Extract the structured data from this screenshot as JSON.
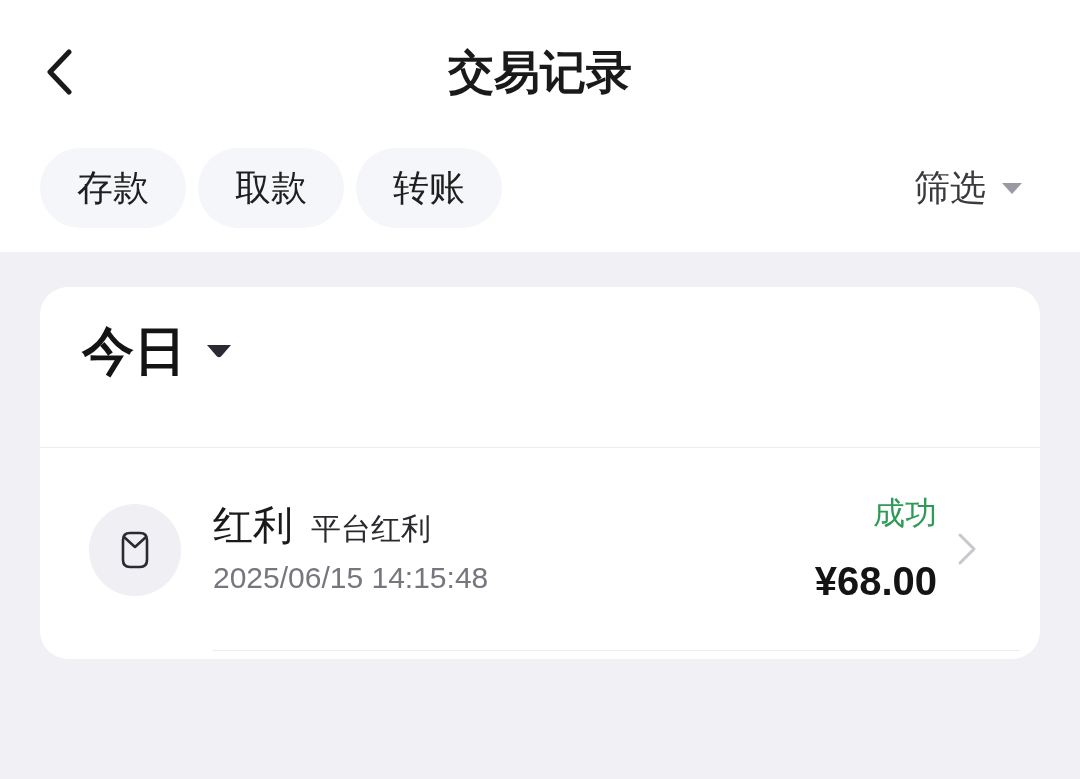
{
  "header": {
    "title": "交易记录"
  },
  "type_tabs": [
    {
      "label": "存款",
      "selected": false
    },
    {
      "label": "取款",
      "selected": false
    },
    {
      "label": "转账",
      "selected": false
    }
  ],
  "filter": {
    "label": "筛选"
  },
  "period": {
    "label": "今日"
  },
  "transactions": [
    {
      "title": "红利",
      "subtitle": "平台红利",
      "time": "2025/06/15 14:15:48",
      "status": {
        "label": "成功",
        "kind": "success"
      },
      "amount": "¥68.00"
    }
  ]
}
